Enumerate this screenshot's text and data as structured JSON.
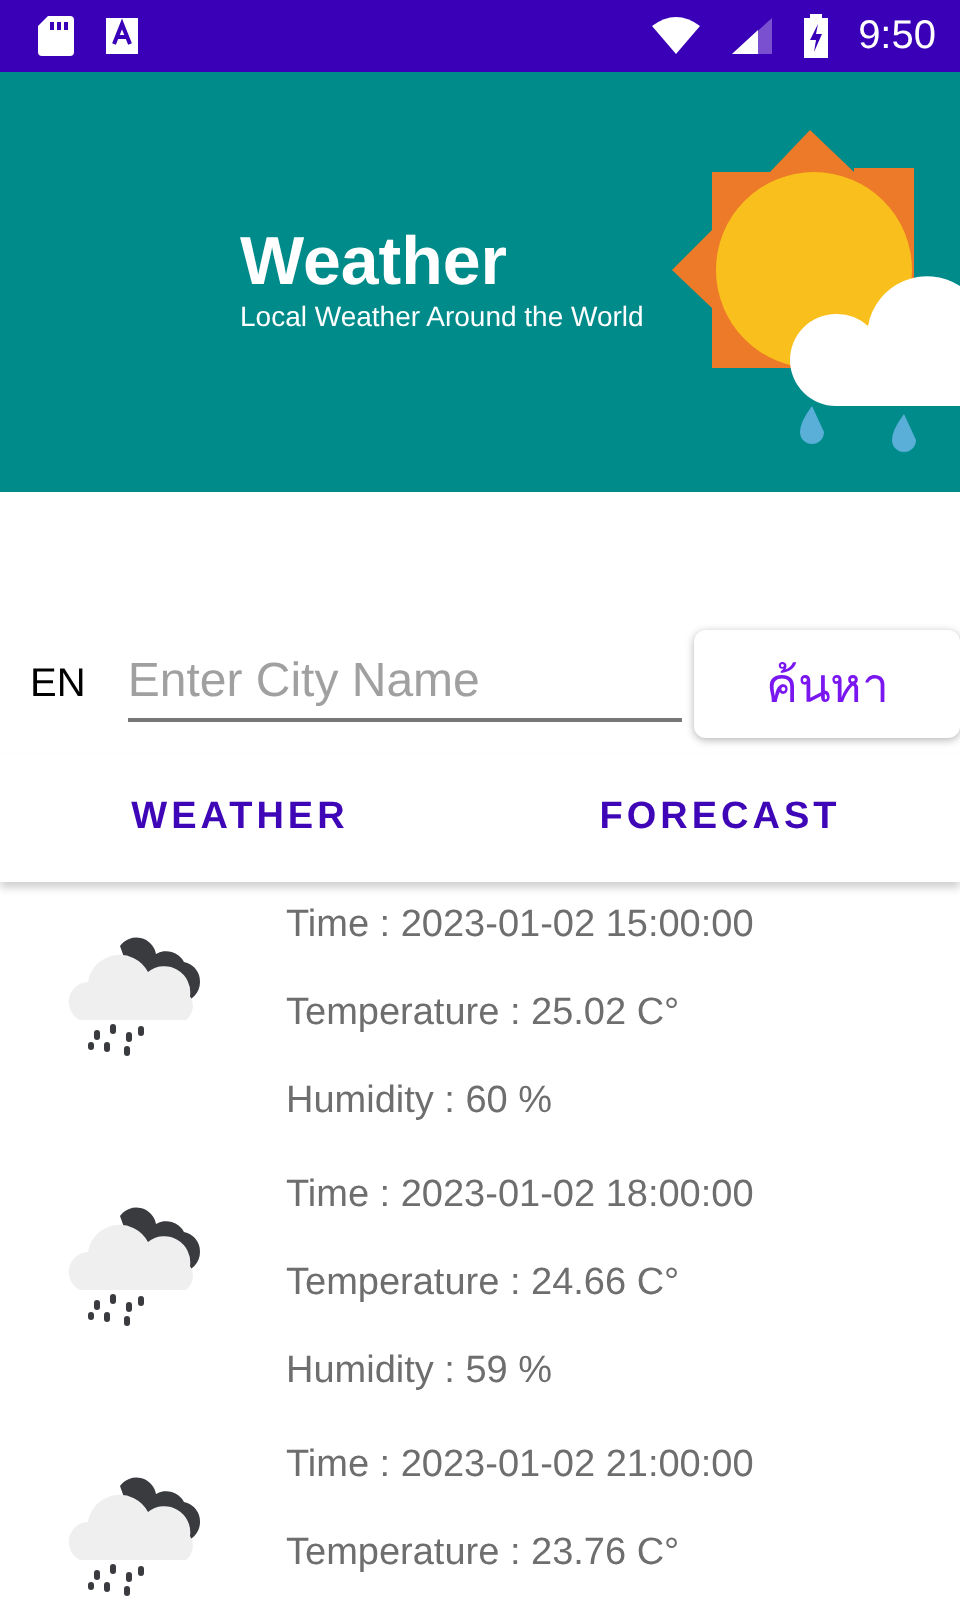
{
  "status_bar": {
    "time": "9:50"
  },
  "header": {
    "title": "Weather",
    "subtitle": "Local Weather Around the World"
  },
  "search": {
    "language": "EN",
    "placeholder": "Enter City Name",
    "button": "ค้นหา"
  },
  "tabs": [
    {
      "label": "WEATHER"
    },
    {
      "label": "FORECAST"
    }
  ],
  "forecast": [
    {
      "time": "Time : 2023-01-02 15:00:00",
      "temperature": "Temperature : 25.02 C°",
      "humidity": "Humidity : 60 %"
    },
    {
      "time": "Time : 2023-01-02 18:00:00",
      "temperature": "Temperature : 24.66 C°",
      "humidity": "Humidity : 59 %"
    },
    {
      "time": "Time : 2023-01-02 21:00:00",
      "temperature": "Temperature : 23.76 C°"
    }
  ]
}
